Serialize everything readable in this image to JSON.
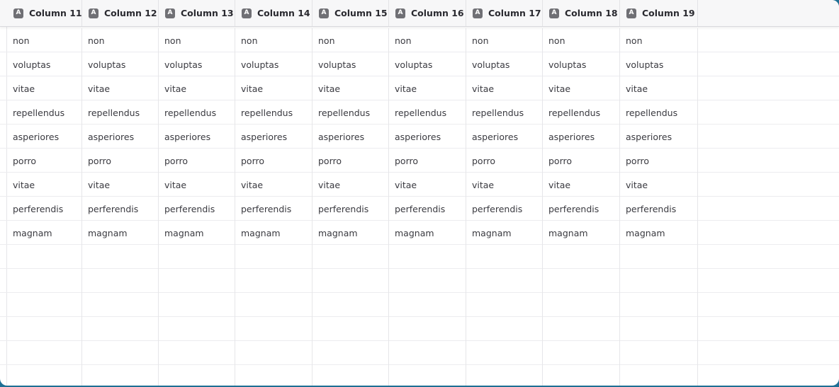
{
  "columns": [
    {
      "label": "Column 11",
      "type_icon": "A"
    },
    {
      "label": "Column 12",
      "type_icon": "A"
    },
    {
      "label": "Column 13",
      "type_icon": "A"
    },
    {
      "label": "Column 14",
      "type_icon": "A"
    },
    {
      "label": "Column 15",
      "type_icon": "A"
    },
    {
      "label": "Column 16",
      "type_icon": "A"
    },
    {
      "label": "Column 17",
      "type_icon": "A"
    },
    {
      "label": "Column 18",
      "type_icon": "A"
    },
    {
      "label": "Column 19",
      "type_icon": "A"
    }
  ],
  "rows": [
    [
      "non",
      "non",
      "non",
      "non",
      "non",
      "non",
      "non",
      "non",
      "non"
    ],
    [
      "voluptas",
      "voluptas",
      "voluptas",
      "voluptas",
      "voluptas",
      "voluptas",
      "voluptas",
      "voluptas",
      "voluptas"
    ],
    [
      "vitae",
      "vitae",
      "vitae",
      "vitae",
      "vitae",
      "vitae",
      "vitae",
      "vitae",
      "vitae"
    ],
    [
      "repellendus",
      "repellendus",
      "repellendus",
      "repellendus",
      "repellendus",
      "repellendus",
      "repellendus",
      "repellendus",
      "repellendus"
    ],
    [
      "asperiores",
      "asperiores",
      "asperiores",
      "asperiores",
      "asperiores",
      "asperiores",
      "asperiores",
      "asperiores",
      "asperiores"
    ],
    [
      "porro",
      "porro",
      "porro",
      "porro",
      "porro",
      "porro",
      "porro",
      "porro",
      "porro"
    ],
    [
      "vitae",
      "vitae",
      "vitae",
      "vitae",
      "vitae",
      "vitae",
      "vitae",
      "vitae",
      "vitae"
    ],
    [
      "perferendis",
      "perferendis",
      "perferendis",
      "perferendis",
      "perferendis",
      "perferendis",
      "perferendis",
      "perferendis",
      "perferendis"
    ],
    [
      "magnam",
      "magnam",
      "magnam",
      "magnam",
      "magnam",
      "magnam",
      "magnam",
      "magnam",
      "magnam"
    ],
    [
      "",
      "",
      "",
      "",
      "",
      "",
      "",
      "",
      ""
    ],
    [
      "",
      "",
      "",
      "",
      "",
      "",
      "",
      "",
      ""
    ],
    [
      "",
      "",
      "",
      "",
      "",
      "",
      "",
      "",
      ""
    ],
    [
      "",
      "",
      "",
      "",
      "",
      "",
      "",
      "",
      ""
    ],
    [
      "",
      "",
      "",
      "",
      "",
      "",
      "",
      "",
      ""
    ],
    [
      "",
      "",
      "",
      "",
      "",
      "",
      "",
      "",
      ""
    ]
  ],
  "colors": {
    "background": "#1e6f94",
    "header_bg": "#f7f7f8",
    "type_icon_bg": "#707075"
  },
  "icons": {
    "column_type": "text-type-icon"
  }
}
